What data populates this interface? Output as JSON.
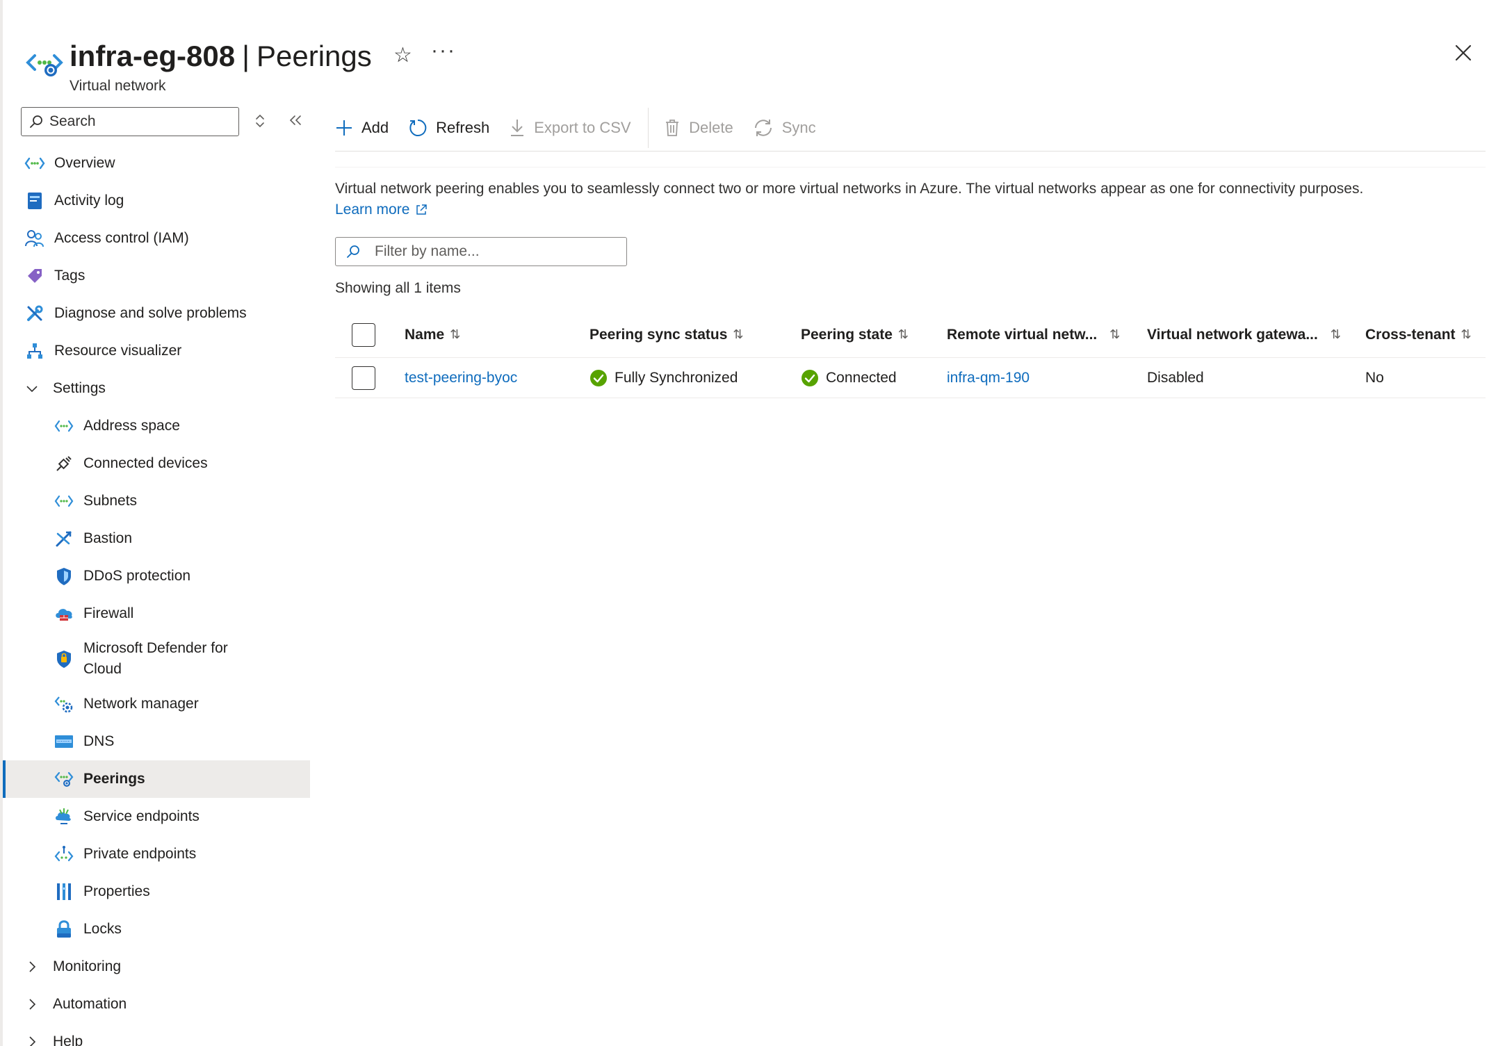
{
  "header": {
    "resource_name": "infra-eg-808",
    "separator": "|",
    "blade_title": "Peerings",
    "subtitle": "Virtual network",
    "more_label": "···"
  },
  "sidebar": {
    "search_placeholder": "Search",
    "items": [
      {
        "label": "Overview",
        "icon": "vnet-icon"
      },
      {
        "label": "Activity log",
        "icon": "activity-log-icon"
      },
      {
        "label": "Access control (IAM)",
        "icon": "iam-icon"
      },
      {
        "label": "Tags",
        "icon": "tag-icon"
      },
      {
        "label": "Diagnose and solve problems",
        "icon": "wrench-icon"
      },
      {
        "label": "Resource visualizer",
        "icon": "visualizer-icon"
      },
      {
        "label": "Settings",
        "icon": "chevron-down-icon"
      }
    ],
    "settings_items": [
      {
        "label": "Address space",
        "icon": "address-space-icon"
      },
      {
        "label": "Connected devices",
        "icon": "plug-icon"
      },
      {
        "label": "Subnets",
        "icon": "subnets-icon"
      },
      {
        "label": "Bastion",
        "icon": "bastion-icon"
      },
      {
        "label": "DDoS protection",
        "icon": "shield-icon"
      },
      {
        "label": "Firewall",
        "icon": "firewall-icon"
      },
      {
        "label": "Microsoft Defender for Cloud",
        "icon": "defender-icon"
      },
      {
        "label": "Network manager",
        "icon": "network-manager-icon"
      },
      {
        "label": "DNS",
        "icon": "dns-icon"
      },
      {
        "label": "Peerings",
        "icon": "peerings-icon",
        "selected": true
      },
      {
        "label": "Service endpoints",
        "icon": "service-endpoints-icon"
      },
      {
        "label": "Private endpoints",
        "icon": "private-endpoints-icon"
      },
      {
        "label": "Properties",
        "icon": "properties-icon"
      },
      {
        "label": "Locks",
        "icon": "lock-icon"
      }
    ],
    "groups": [
      {
        "label": "Monitoring",
        "icon": "chevron-right-icon"
      },
      {
        "label": "Automation",
        "icon": "chevron-right-icon"
      },
      {
        "label": "Help",
        "icon": "chevron-right-icon"
      }
    ]
  },
  "toolbar": {
    "add": "Add",
    "refresh": "Refresh",
    "export": "Export to CSV",
    "delete": "Delete",
    "sync": "Sync"
  },
  "main": {
    "description": "Virtual network peering enables you to seamlessly connect two or more virtual networks in Azure. The virtual networks appear as one for connectivity purposes.",
    "learn_more": "Learn more",
    "filter_placeholder": "Filter by name...",
    "showing": "Showing all 1 items"
  },
  "table": {
    "columns": [
      "Name",
      "Peering sync status",
      "Peering state",
      "Remote virtual netw...",
      "Virtual network gatewa...",
      "Cross-tenant"
    ],
    "sort_glyph": "⇅",
    "rows": [
      {
        "name": "test-peering-byoc",
        "sync_status": "Fully Synchronized",
        "state": "Connected",
        "remote_vnet": "infra-qm-190",
        "gateway": "Disabled",
        "cross_tenant": "No"
      }
    ]
  },
  "colors": {
    "accent": "#0f6cbd",
    "success": "#57a300",
    "selected_bg": "#edebe9",
    "disabled_text": "#a19f9d"
  }
}
